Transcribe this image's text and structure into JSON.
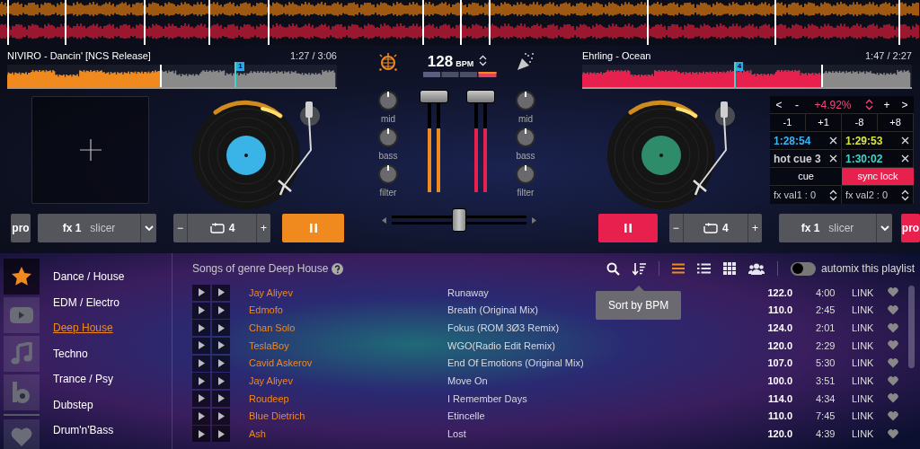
{
  "decks": [
    {
      "title": "NIVIRO - Dancin' [NCS Release]",
      "time": "1:27 / 3:06",
      "color": "#f0891e",
      "waveform": {
        "level": 0.47,
        "cue": {
          "label": "1",
          "level": 0.69
        }
      },
      "pro": {
        "label": "pro",
        "on": false
      },
      "fx": {
        "name": "fx 1",
        "effect": "slicer"
      },
      "loop": {
        "minus": "−",
        "value": "4",
        "plus": "+"
      },
      "playing": true
    },
    {
      "title": "Ehrling - Ocean",
      "time": "1:47 / 2:27",
      "color": "#e8204e",
      "waveform": {
        "level": 0.73,
        "cue": {
          "label": "4",
          "level": 0.46
        }
      },
      "pro": {
        "label": "pro",
        "on": true
      },
      "fx": {
        "name": "fx 1",
        "effect": "slicer"
      },
      "loop": {
        "minus": "−",
        "value": "4",
        "plus": "+"
      },
      "playing": true,
      "panel": {
        "tempo_row": [
          {
            "kind": "button",
            "label": "<"
          },
          {
            "kind": "button",
            "label": "-"
          },
          {
            "kind": "value",
            "label": "+4.92%"
          },
          {
            "kind": "spinner"
          },
          {
            "kind": "button",
            "label": "+"
          },
          {
            "kind": "button",
            "label": ">"
          }
        ],
        "beat_jump": [
          "-1",
          "+1",
          "-8",
          "+8"
        ],
        "hot_cues": [
          {
            "label": "1:28:54",
            "color": "#3ab4f2"
          },
          {
            "label": "1:29:53",
            "color": "#d8e63c"
          },
          {
            "label": "hot cue 3",
            "color": "#cfcfcf"
          },
          {
            "label": "1:30:02",
            "color": "#3fd6c8"
          }
        ],
        "cue_buttons": [
          {
            "label": "cue",
            "on": false
          },
          {
            "label": "sync lock",
            "on": true
          }
        ],
        "fx_values": [
          "fx val1 : 0",
          "fx val2 : 0"
        ]
      }
    }
  ],
  "mixer": {
    "bpm": "128",
    "bpm_unit": "BPM",
    "channels": [
      {
        "knobs": [
          "mid",
          "bass",
          "filter"
        ],
        "fader": {
          "level": 1
        },
        "meter": {
          "level": 0.68
        }
      },
      {
        "knobs": [
          "mid",
          "bass",
          "filter"
        ],
        "fader": {
          "level": 1
        },
        "meter": {
          "level": 0.68
        }
      }
    ],
    "crossfader": {
      "level": 0.5
    }
  },
  "sources": [
    {
      "kind": "star",
      "selected": true
    },
    {
      "kind": "video",
      "selected": false
    },
    {
      "kind": "music",
      "selected": false
    },
    {
      "kind": "b",
      "selected": false
    },
    {
      "kind": "heart",
      "selected": false
    }
  ],
  "genres": [
    {
      "label": "Dance / House",
      "selected": false
    },
    {
      "label": "EDM / Electro",
      "selected": false
    },
    {
      "label": "Deep House",
      "selected": true
    },
    {
      "label": "Techno",
      "selected": false
    },
    {
      "label": "Trance / Psy",
      "selected": false
    },
    {
      "label": "Dubstep",
      "selected": false
    },
    {
      "label": "Drum'n'Bass",
      "selected": false
    }
  ],
  "playlist": {
    "title": "Songs of genre Deep House",
    "view_modes": [
      {
        "kind": "compact",
        "selected": true
      },
      {
        "kind": "list",
        "selected": false
      },
      {
        "kind": "grid",
        "selected": false
      },
      {
        "kind": "users",
        "selected": false
      }
    ],
    "automix": {
      "label": "automix this playlist",
      "on": false
    },
    "tooltip": "Sort by BPM",
    "rows": [
      {
        "artist": "Jay Aliyev",
        "title": "Runaway",
        "bpm": "122.0",
        "time": "4:00",
        "link": "LINK"
      },
      {
        "artist": "Edmofo",
        "title": "Breath (Original Mix)",
        "bpm": "110.0",
        "time": "2:45",
        "link": "LINK"
      },
      {
        "artist": "Chan Solo",
        "title": "Fokus (ROM 3Ø3 Remix)",
        "bpm": "124.0",
        "time": "2:01",
        "link": "LINK"
      },
      {
        "artist": "TeslaBoy",
        "title": "WGO(Radio Edit Remix)",
        "bpm": "120.0",
        "time": "2:29",
        "link": "LINK"
      },
      {
        "artist": "Cavid Askerov",
        "title": "End Of Emotions (Original Mix)",
        "bpm": "107.0",
        "time": "5:30",
        "link": "LINK"
      },
      {
        "artist": "Jay Aliyev",
        "title": "Move On",
        "bpm": "100.0",
        "time": "3:51",
        "link": "LINK"
      },
      {
        "artist": "Roudeep",
        "title": "I Remember Days",
        "bpm": "114.0",
        "time": "4:34",
        "link": "LINK"
      },
      {
        "artist": "Blue Dietrich",
        "title": "Etincelle",
        "bpm": "110.0",
        "time": "7:45",
        "link": "LINK"
      },
      {
        "artist": "Ash",
        "title": "Lost",
        "bpm": "120.0",
        "time": "4:39",
        "link": "LINK"
      }
    ]
  }
}
